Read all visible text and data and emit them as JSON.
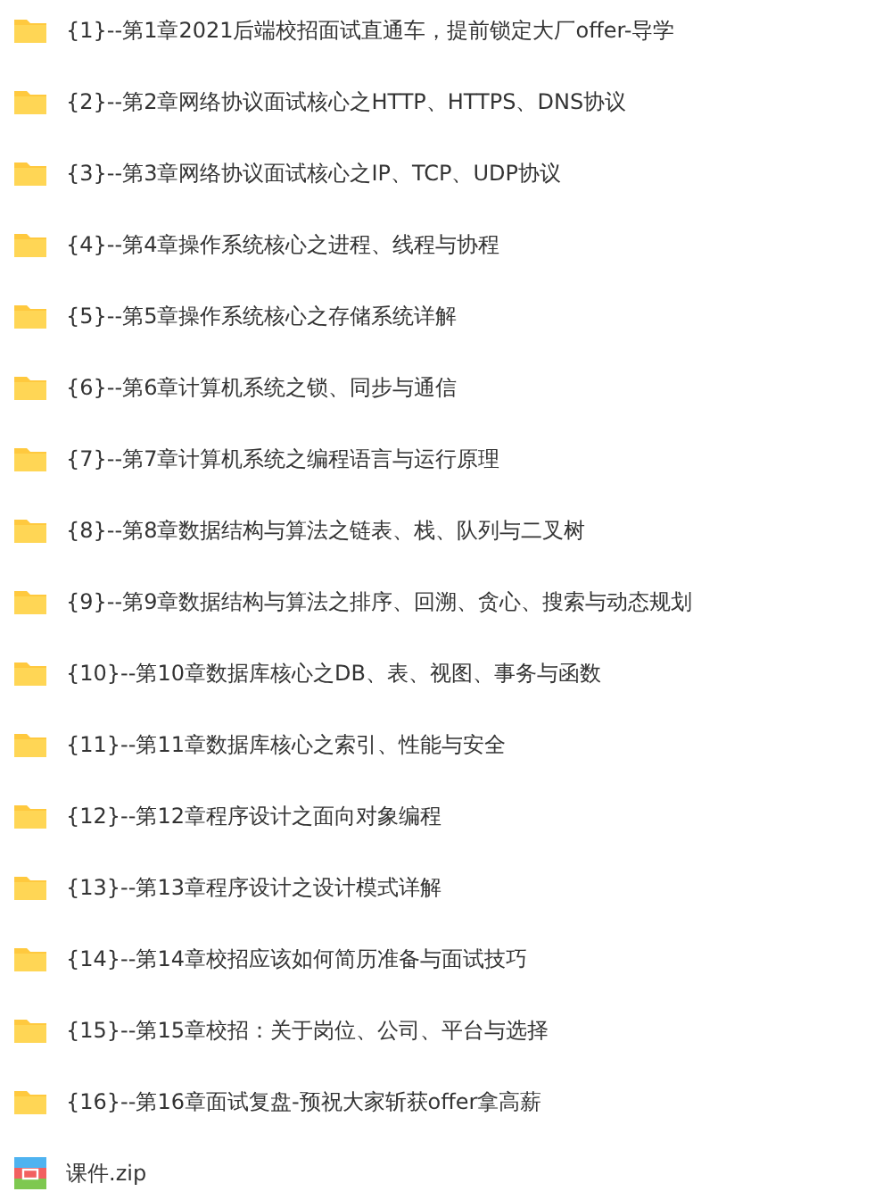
{
  "files": [
    {
      "kind": "folder",
      "name": "{1}--第1章2021后端校招面试直通车，提前锁定大厂offer-导学"
    },
    {
      "kind": "folder",
      "name": "{2}--第2章网络协议面试核心之HTTP、HTTPS、DNS协议"
    },
    {
      "kind": "folder",
      "name": "{3}--第3章网络协议面试核心之IP、TCP、UDP协议"
    },
    {
      "kind": "folder",
      "name": "{4}--第4章操作系统核心之进程、线程与协程"
    },
    {
      "kind": "folder",
      "name": "{5}--第5章操作系统核心之存储系统详解"
    },
    {
      "kind": "folder",
      "name": "{6}--第6章计算机系统之锁、同步与通信"
    },
    {
      "kind": "folder",
      "name": "{7}--第7章计算机系统之编程语言与运行原理"
    },
    {
      "kind": "folder",
      "name": "{8}--第8章数据结构与算法之链表、栈、队列与二叉树"
    },
    {
      "kind": "folder",
      "name": "{9}--第9章数据结构与算法之排序、回溯、贪心、搜索与动态规划"
    },
    {
      "kind": "folder",
      "name": "{10}--第10章数据库核心之DB、表、视图、事务与函数"
    },
    {
      "kind": "folder",
      "name": "{11}--第11章数据库核心之索引、性能与安全"
    },
    {
      "kind": "folder",
      "name": "{12}--第12章程序设计之面向对象编程"
    },
    {
      "kind": "folder",
      "name": "{13}--第13章程序设计之设计模式详解"
    },
    {
      "kind": "folder",
      "name": "{14}--第14章校招应该如何简历准备与面试技巧"
    },
    {
      "kind": "folder",
      "name": "{15}--第15章校招：关于岗位、公司、平台与选择"
    },
    {
      "kind": "folder",
      "name": "{16}--第16章面试复盘-预祝大家斩获offer拿高薪"
    },
    {
      "kind": "zip",
      "name": "课件.zip"
    }
  ]
}
